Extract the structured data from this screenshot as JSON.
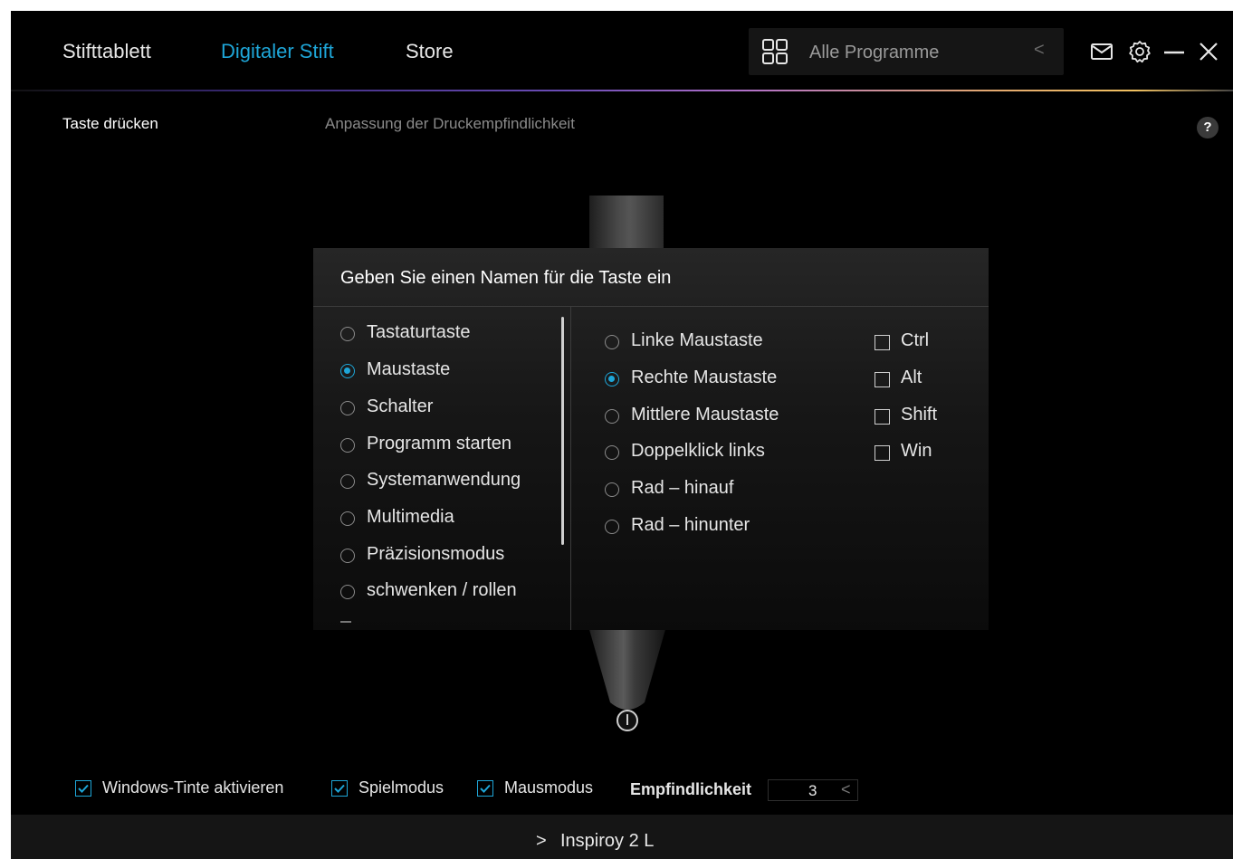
{
  "nav": {
    "tabs": [
      "Stifttablett",
      "Digitaler Stift",
      "Store"
    ],
    "active": "Digitaler Stift",
    "program_selector": "Alle Programme"
  },
  "subtabs": [
    "Taste drücken",
    "Anpassung der Druckempfindlichkeit"
  ],
  "help_label": "?",
  "dialog": {
    "title": "Geben Sie einen Namen für die Taste ein",
    "categories": [
      "Tastaturtaste",
      "Maustaste",
      "Schalter",
      "Programm starten",
      "Systemanwendung",
      "Multimedia",
      "Präzisionsmodus",
      "schwenken / rollen"
    ],
    "selected_category": "Maustaste",
    "mouse_options": [
      "Linke Maustaste",
      "Rechte Maustaste",
      "Mittlere Maustaste",
      "Doppelklick links",
      "Rad – hinauf",
      "Rad – hinunter"
    ],
    "selected_mouse_option": "Rechte Maustaste",
    "modifiers": [
      "Ctrl",
      "Alt",
      "Shift",
      "Win"
    ]
  },
  "options": {
    "windows_ink": "Windows-Tinte aktivieren",
    "game_mode": "Spielmodus",
    "mouse_mode": "Mausmodus",
    "sensitivity_label": "Empfindlichkeit",
    "sensitivity_value": "3"
  },
  "footer": {
    "device": "Inspiroy 2 L"
  },
  "colors": {
    "accent": "#1ea6d8",
    "background": "#000000"
  }
}
